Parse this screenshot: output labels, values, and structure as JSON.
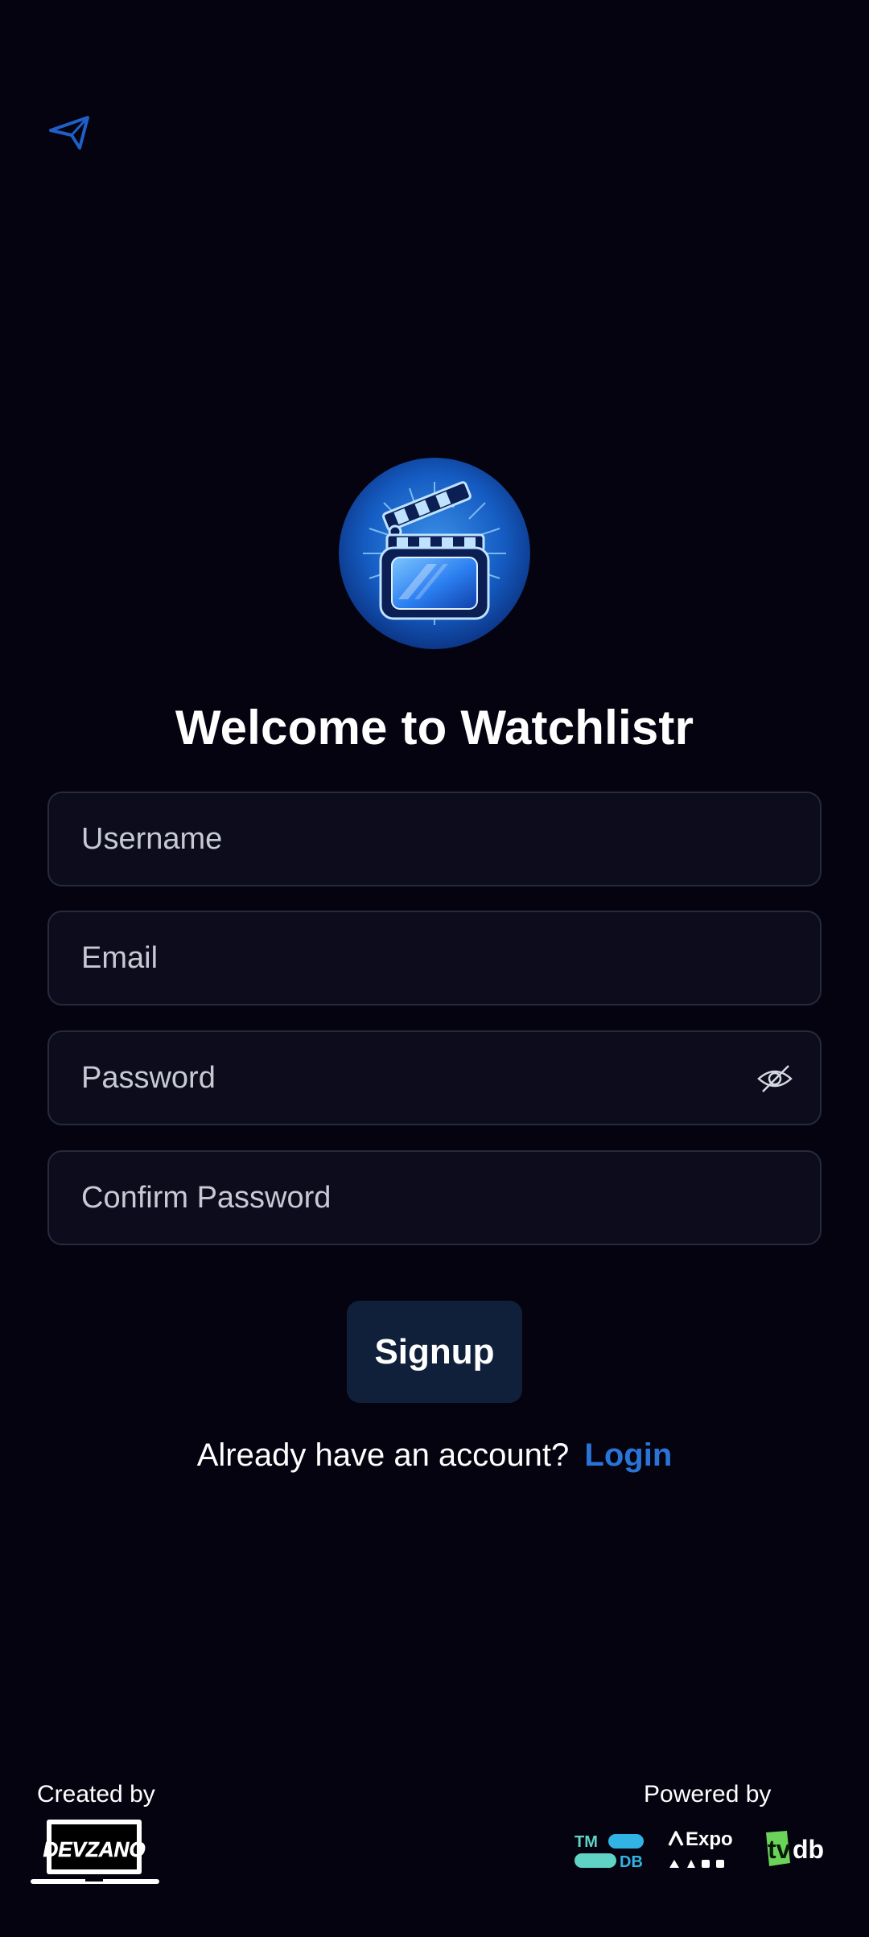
{
  "nav": {
    "back_icon": "paper-plane-back-icon"
  },
  "header": {
    "app_logo_icon": "film-clapperboard-icon",
    "title": "Welcome to Watchlistr"
  },
  "form": {
    "username_placeholder": "Username",
    "username_value": "",
    "email_placeholder": "Email",
    "email_value": "",
    "password_placeholder": "Password",
    "password_value": "",
    "password_toggle_icon": "eye-slash-icon",
    "confirm_placeholder": "Confirm Password",
    "confirm_value": "",
    "signup_label": "Signup"
  },
  "login_prompt": {
    "text": "Already have an account?",
    "link_label": "Login"
  },
  "footer": {
    "created_by_label": "Created by",
    "creator_logo_text": "DEVZANO",
    "powered_by_label": "Powered by",
    "tmdb_logo_text": [
      "TM",
      "DB"
    ],
    "expo_logo_text": "Expo",
    "tvdb_logo_text": [
      "tv",
      "db"
    ]
  },
  "colors": {
    "background": "#04030f",
    "field_background": "#0d0c1d",
    "field_border": "#262a3d",
    "button_background": "#11203a",
    "accent": "#2a74d8",
    "tmdb": "#5fd3c4",
    "tvdb": "#6cd35a"
  }
}
